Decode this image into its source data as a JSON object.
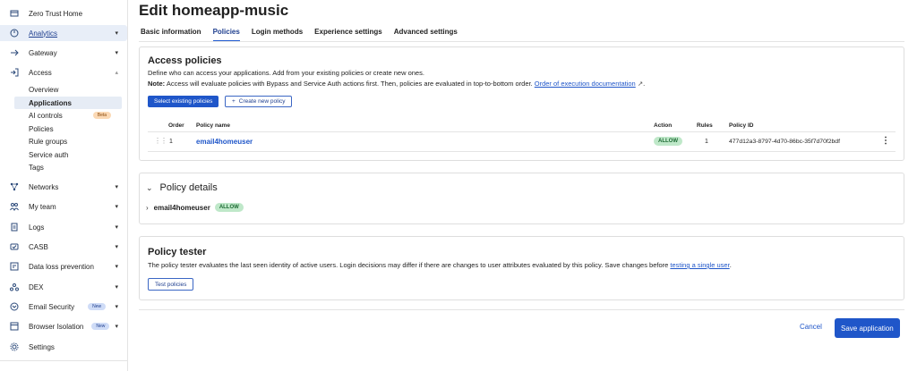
{
  "sidebar": {
    "items": [
      {
        "label": "Zero Trust Home",
        "icon": "home-icon",
        "chev": ""
      },
      {
        "label": "Analytics",
        "icon": "analytics-icon",
        "chev": "▾"
      },
      {
        "label": "Gateway",
        "icon": "gateway-icon",
        "chev": "▾"
      },
      {
        "label": "Access",
        "icon": "access-icon",
        "chev": "▴"
      },
      {
        "label": "Networks",
        "icon": "networks-icon",
        "chev": "▾"
      },
      {
        "label": "My team",
        "icon": "team-icon",
        "chev": "▾"
      },
      {
        "label": "Logs",
        "icon": "logs-icon",
        "chev": "▾"
      },
      {
        "label": "CASB",
        "icon": "casb-icon",
        "chev": "▾"
      },
      {
        "label": "Data loss prevention",
        "icon": "dlp-icon",
        "chev": "▾"
      },
      {
        "label": "DEX",
        "icon": "dex-icon",
        "chev": "▾"
      },
      {
        "label": "Email Security",
        "icon": "email-icon",
        "chev": "▾",
        "badge": "New"
      },
      {
        "label": "Browser Isolation",
        "icon": "browser-icon",
        "chev": "▾",
        "badge": "New"
      },
      {
        "label": "Settings",
        "icon": "gear-icon",
        "chev": ""
      }
    ],
    "access_sub": [
      {
        "label": "Overview"
      },
      {
        "label": "Applications"
      },
      {
        "label": "AI controls",
        "badge": "Beta"
      },
      {
        "label": "Policies"
      },
      {
        "label": "Rule groups"
      },
      {
        "label": "Service auth"
      },
      {
        "label": "Tags"
      }
    ]
  },
  "page": {
    "title": "Edit homeapp-music",
    "tabs": [
      "Basic information",
      "Policies",
      "Login methods",
      "Experience settings",
      "Advanced settings"
    ]
  },
  "access_policies": {
    "title": "Access policies",
    "desc1": "Define who can access your applications. Add from your existing policies or create new ones.",
    "note_label": "Note:",
    "note_text": " Access will evaluate policies with Bypass and Service Auth actions first. Then, policies are evaluated in top-to-bottom order. ",
    "note_link": "Order of execution documentation",
    "select_btn": "Select existing policies",
    "create_btn": "Create new policy",
    "columns": {
      "order": "Order",
      "name": "Policy name",
      "action": "Action",
      "rules": "Rules",
      "id": "Policy ID"
    },
    "rows": [
      {
        "order": "1",
        "name": "email4homeuser",
        "action": "ALLOW",
        "rules": "1",
        "id": "477d12a3-8797-4d70-86bc-35f7d70f2bdf"
      }
    ]
  },
  "policy_details": {
    "title": "Policy details",
    "item_name": "email4homeuser",
    "item_action": "ALLOW"
  },
  "policy_tester": {
    "title": "Policy tester",
    "desc": "The policy tester evaluates the last seen identity of active users. Login decisions may differ if there are changes to user attributes evaluated by this policy. Save changes before ",
    "link": "testing a single user",
    "desc_end": ".",
    "button": "Test policies"
  },
  "footer": {
    "cancel": "Cancel",
    "save": "Save application"
  }
}
